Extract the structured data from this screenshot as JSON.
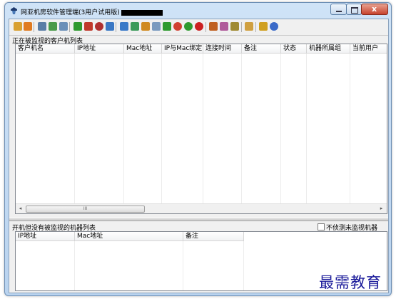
{
  "window": {
    "title": "网亚机房软件管理端(3用户试用版)",
    "controls": {
      "minimize": "minimize",
      "maximize": "maximize",
      "close": "x"
    }
  },
  "toolbar": {
    "icons": [
      {
        "name": "wrench-icon",
        "color": "#d9a030"
      },
      {
        "name": "users-icon",
        "color": "#e07b20"
      },
      {
        "name": "monitor-icon",
        "color": "#5a7ea6"
      },
      {
        "name": "group-icon",
        "color": "#4a9a4a"
      },
      {
        "name": "magnifier-icon",
        "color": "#6a8fb8"
      },
      {
        "name": "arrow-right-icon",
        "color": "#2f9a2f"
      },
      {
        "name": "pen-icon",
        "color": "#c0392b"
      },
      {
        "name": "record-icon",
        "color": "#b03030"
      },
      {
        "name": "message-icon",
        "color": "#3b78c4"
      },
      {
        "name": "network-icon",
        "color": "#3a7ac8"
      },
      {
        "name": "share-icon",
        "color": "#3c9a5a"
      },
      {
        "name": "transfer-icon",
        "color": "#d08a20"
      },
      {
        "name": "document-icon",
        "color": "#7a9abf"
      },
      {
        "name": "refresh-icon",
        "color": "#2f9a2f"
      },
      {
        "name": "power-icon",
        "color": "#d04030"
      },
      {
        "name": "restart-icon",
        "color": "#2f9a2f"
      },
      {
        "name": "stop-icon",
        "color": "#cc2020"
      },
      {
        "name": "settings-icon",
        "color": "#c06020"
      },
      {
        "name": "tools-icon",
        "color": "#b05a9a"
      },
      {
        "name": "key-icon",
        "color": "#a08a30"
      },
      {
        "name": "tag-icon",
        "color": "#d0a040"
      },
      {
        "name": "star-icon",
        "color": "#d0a020"
      },
      {
        "name": "help-icon",
        "color": "#3a6ac8"
      }
    ]
  },
  "monitored": {
    "label": "正在被监视的客户机列表",
    "columns": [
      "客户机名",
      "IP地址",
      "Mac地址",
      "IP与Mac绑定",
      "连接时间",
      "备注",
      "状态",
      "机器所属组",
      "当前用户"
    ],
    "rows": [],
    "scroll_left": "◂",
    "scroll_right": "▸",
    "scroll_thumb_grip": "III"
  },
  "unmonitored": {
    "label": "开机但没有被监视的机器列表",
    "checkbox_label": "不侦测未监视机器",
    "checkbox_checked": false,
    "columns": [
      "IP地址",
      "Mac地址",
      "备注"
    ],
    "rows": []
  },
  "watermark": "最需教育"
}
